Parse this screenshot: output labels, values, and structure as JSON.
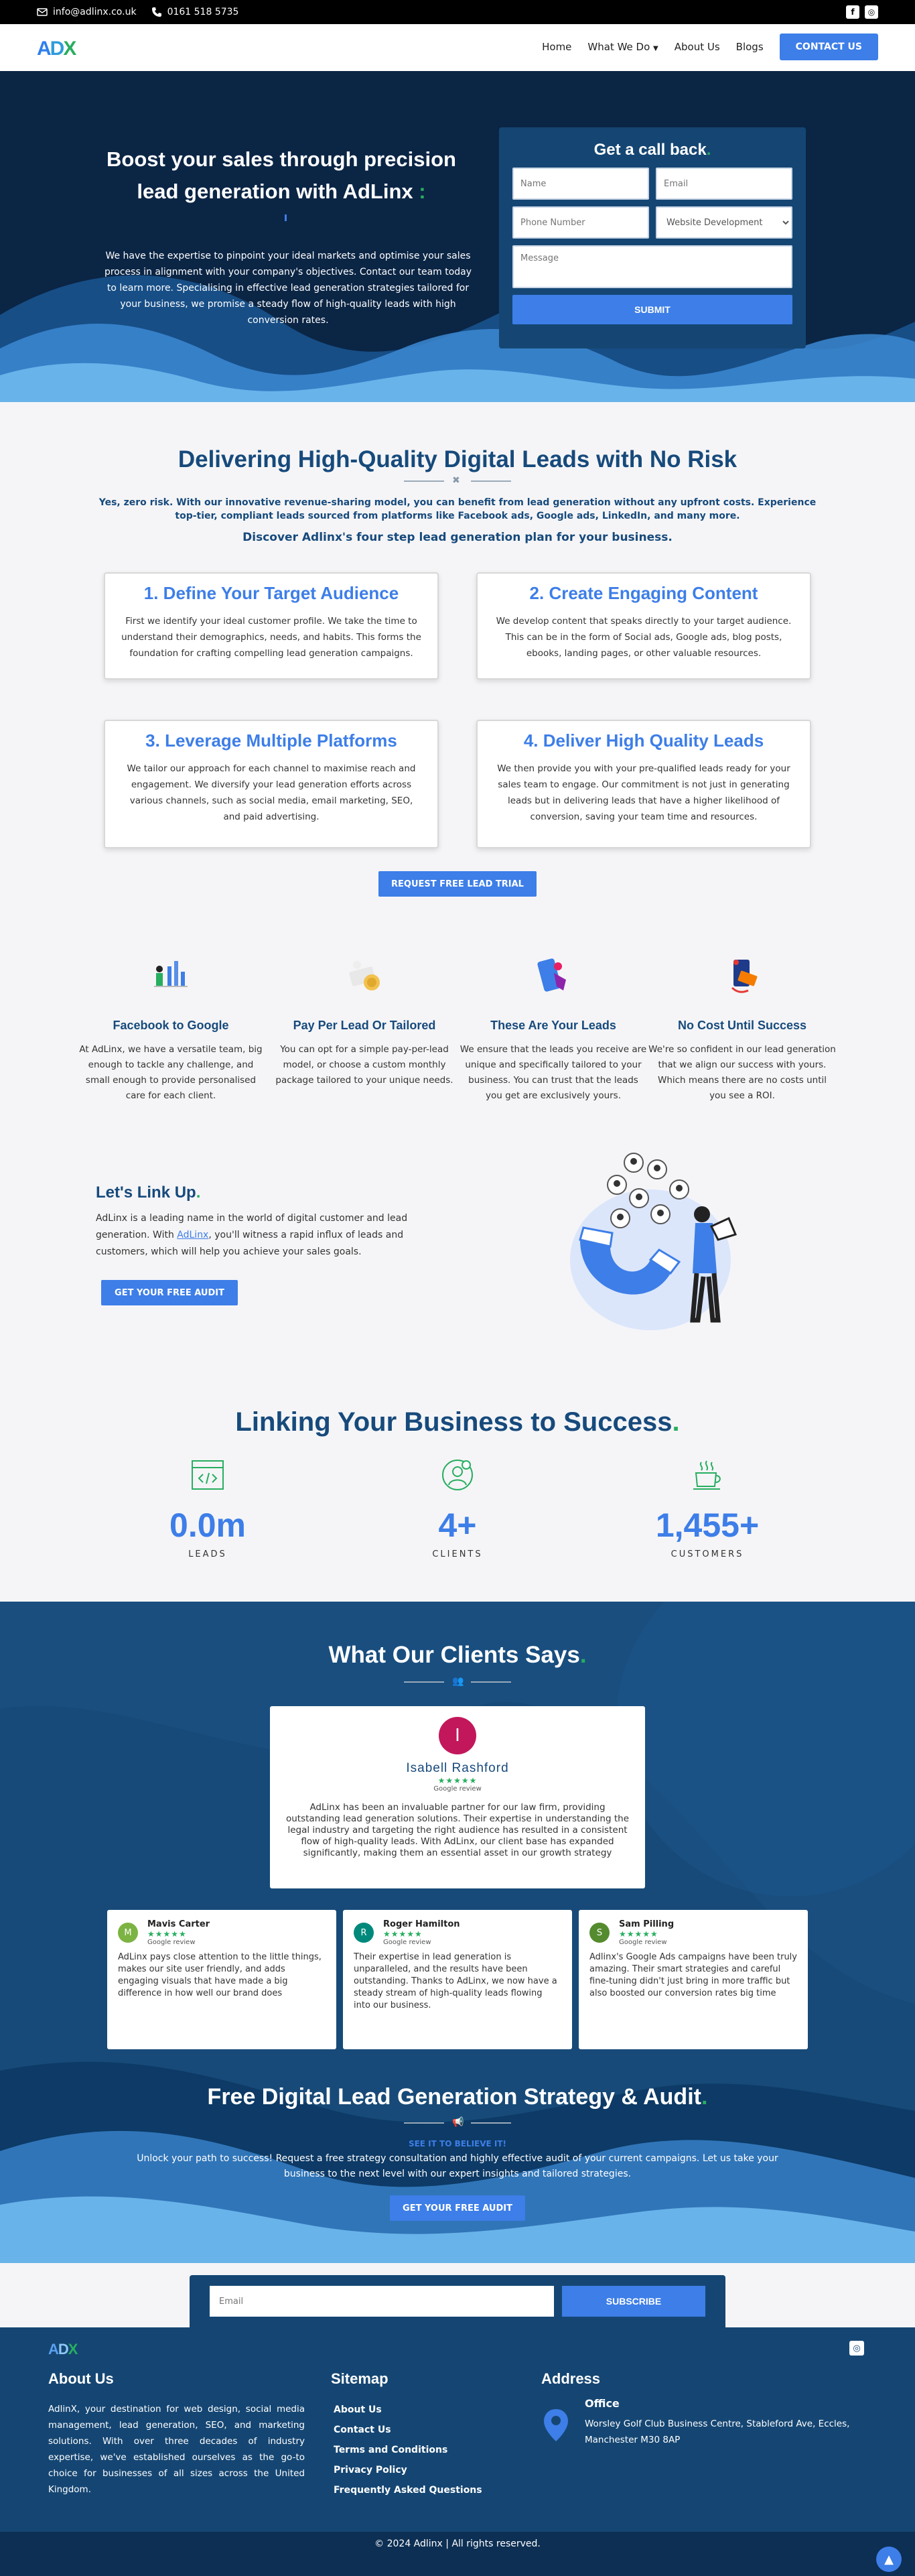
{
  "topbar": {
    "email": "info@adlinx.co.uk",
    "phone": "0161 518 5735"
  },
  "nav": {
    "logo": "ADX",
    "items": [
      "Home",
      "What We Do",
      "About Us",
      "Blogs"
    ],
    "cta": "CONTACT US"
  },
  "hero": {
    "title": "Boost your sales through precision lead generation with AdLinx",
    "title_dot": ":",
    "text": "We have the expertise to pinpoint your ideal markets and optimise your sales process in alignment with your company's objectives. Contact our team today to learn more. Specialising in effective lead generation strategies tailored for your business, we promise a steady flow of high-quality leads with high conversion rates."
  },
  "form": {
    "title": "Get a call back",
    "name_placeholder": "Name",
    "email_placeholder": "Email",
    "phone_placeholder": "Phone Number",
    "service_selected": "Website Development",
    "message_placeholder": "Message",
    "submit": "SUBMIT"
  },
  "leads": {
    "title": "Delivering High-Quality Digital Leads with No Risk",
    "intro": "Yes, zero risk. With our innovative revenue-sharing model, you can benefit from lead generation without any upfront costs. Experience top-tier, compliant leads sourced from platforms like Facebook ads, Google ads, LinkedIn, and many more.",
    "subtitle": "Discover Adlinx's four step lead generation plan for your business.",
    "steps": [
      {
        "title": "1. Define Your Target Audience",
        "text": "First we identify your ideal customer profile. We take the time to understand their demographics, needs, and habits. This forms the foundation for crafting compelling lead generation campaigns."
      },
      {
        "title": "2. Create Engaging Content",
        "text": "We develop content that speaks directly to your target audience. This can be in the form of Social ads, Google ads, blog posts, ebooks, landing pages, or other valuable resources."
      },
      {
        "title": "3. Leverage Multiple Platforms",
        "text": "We tailor our approach for each channel to maximise reach and engagement. We diversify your lead generation efforts across various channels, such as social media, email marketing, SEO, and paid advertising."
      },
      {
        "title": "4. Deliver High Quality Leads",
        "text": "We then provide you with your pre-qualified leads ready for your sales team to engage. Our commitment is not just in generating leads but in delivering leads that have a higher likelihood of conversion, saving your team time and resources."
      }
    ],
    "cta": "REQUEST FREE LEAD TRIAL"
  },
  "features": [
    {
      "title": "Facebook to Google",
      "text": "At AdLinx, we have a versatile team, big enough to tackle any challenge, and small enough to provide personalised care for each client.",
      "icon": "team-chart-icon"
    },
    {
      "title": "Pay Per Lead Or Tailored",
      "text": "You can opt for a simple pay-per-lead model, or choose a custom monthly package tailored to your unique needs.",
      "icon": "money-icon"
    },
    {
      "title": "These Are Your Leads",
      "text": "We ensure that the leads you receive are unique and specifically tailored to your business. You can trust that the leads you get are exclusively yours.",
      "icon": "mobile-user-icon"
    },
    {
      "title": "No Cost Until Success",
      "text": "We're so confident in our lead generation that we align our success with yours. Which means there are no costs until you see a ROI.",
      "icon": "phone-card-icon"
    }
  ],
  "linkup": {
    "title": "Let's Link Up",
    "text_before": "AdLinx is a leading name in the world of digital customer and lead generation. With",
    "text_link": "AdLinx",
    "text_after": ", you'll witness a rapid influx of leads and customers, which will help you achieve your sales goals.",
    "cta": "GET YOUR FREE AUDIT"
  },
  "success": {
    "title": "Linking Your Business to Success",
    "stats": [
      {
        "value": "0.0m",
        "label": "LEADS",
        "icon": "code-window-icon"
      },
      {
        "value": "4+",
        "label": "CLIENTS",
        "icon": "user-badge-icon"
      },
      {
        "value": "1,455+",
        "label": "CUSTOMERS",
        "icon": "coffee-cup-icon"
      }
    ]
  },
  "testimonials": {
    "title": "What Our Clients Says",
    "featured": {
      "initial": "I",
      "name": "Isabell Rashford",
      "stars": "★★★★★",
      "source": "Google review",
      "text": "AdLinx has been an invaluable partner for our law firm, providing outstanding lead generation solutions. Their expertise in understanding the legal industry and targeting the right audience has resulted in a consistent flow of high-quality leads. With AdLinx, our client base has expanded significantly, making them an essential asset in our growth strategy",
      "color": "#c2185b"
    },
    "reviews": [
      {
        "initial": "M",
        "name": "Mavis Carter",
        "stars": "★★★★★",
        "source": "Google review",
        "text": "AdLinx pays close attention to the little things, makes our site user friendly, and adds engaging visuals that have made a big difference in how well our brand does",
        "color": "#7cb342"
      },
      {
        "initial": "R",
        "name": "Roger Hamilton",
        "stars": "★★★★★",
        "source": "Google review",
        "text": "Their expertise in lead generation is unparalleled, and the results have been outstanding. Thanks to AdLinx, we now have a steady stream of high-quality leads flowing into our business.",
        "color": "#00897b"
      },
      {
        "initial": "S",
        "name": "Sam Pilling",
        "stars": "★★★★★",
        "source": "Google review",
        "text": "Adlinx's Google Ads campaigns have been truly amazing. Their smart strategies and careful fine-tuning didn't just bring in more traffic but also boosted our conversion rates big time",
        "color": "#558b2f"
      }
    ]
  },
  "audit": {
    "title": "Free Digital Lead Generation Strategy & Audit",
    "see": "SEE IT TO BELIEVE IT!",
    "text": "Unlock your path to success! Request a free strategy consultation and highly effective audit of your current campaigns. Let us take your business to the next level with our expert insights and tailored strategies.",
    "cta": "GET YOUR FREE AUDIT"
  },
  "newsletter": {
    "placeholder": "Email",
    "button": "SUBSCRIBE"
  },
  "footer": {
    "logo": "ADX",
    "about_title": "About Us",
    "about_text": "AdlinX, your destination for web design, social media management, lead generation, SEO, and marketing solutions. With over three decades of industry expertise, we've established ourselves as the go-to choice for businesses of all sizes across the United Kingdom.",
    "sitemap_title": "Sitemap",
    "sitemap": [
      "About Us",
      "Contact Us",
      "Terms and Conditions",
      "Privacy Policy",
      "Frequently Asked Questions"
    ],
    "address_title": "Address",
    "office_label": "Office",
    "address": "Worsley Golf Club Business Centre, Stableford Ave, Eccles, Manchester M30 8AP"
  },
  "copyright": "© 2024 Adlinx | All rights reserved.",
  "colors": {
    "accent": "#3d7ee8",
    "navy": "#174a7c",
    "hero_bg": "#0b2545",
    "green": "#27ae60"
  }
}
